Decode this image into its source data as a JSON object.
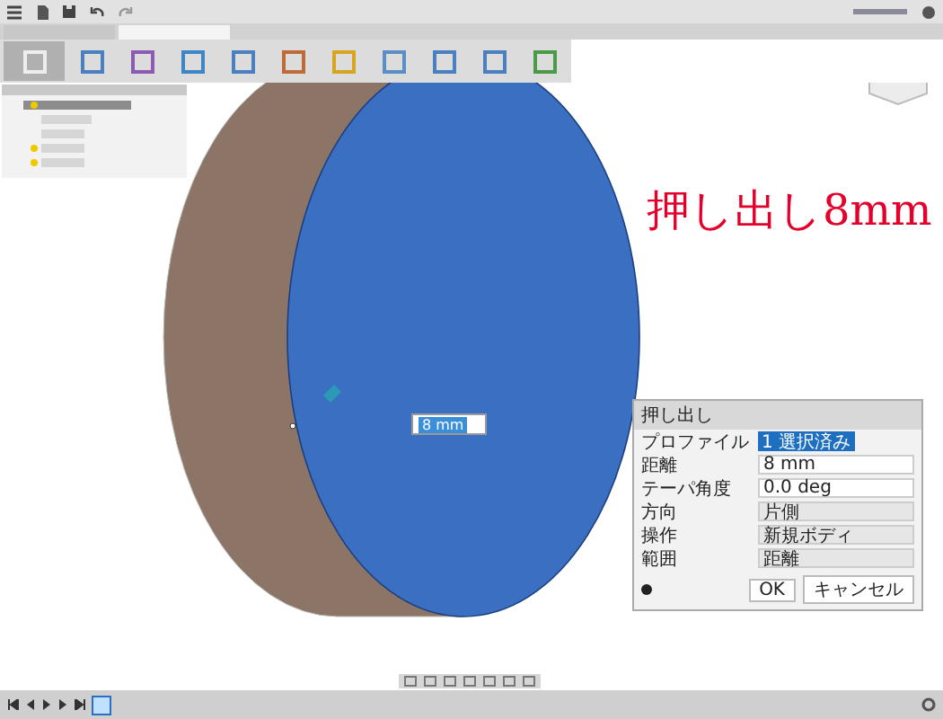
{
  "tabs": [
    {
      "selected": false
    },
    {
      "selected": true
    }
  ],
  "annotation": "押し出し8mm",
  "distance_input": {
    "value": "8 mm"
  },
  "dialog": {
    "title": "押し出し",
    "rows": [
      {
        "label": "プロファイル",
        "value": "1 選択済み",
        "kind": "select"
      },
      {
        "label": "距離",
        "value": "8 mm",
        "kind": "field"
      },
      {
        "label": "テーパ角度",
        "value": "0.0 deg",
        "kind": "field"
      },
      {
        "label": "方向",
        "value": "片側",
        "kind": "dropdown"
      },
      {
        "label": "操作",
        "value": "新規ボディ",
        "kind": "dropdown"
      },
      {
        "label": "範囲",
        "value": "距離",
        "kind": "dropdown"
      }
    ],
    "buttons": [
      "OK",
      "キャンセル"
    ]
  }
}
